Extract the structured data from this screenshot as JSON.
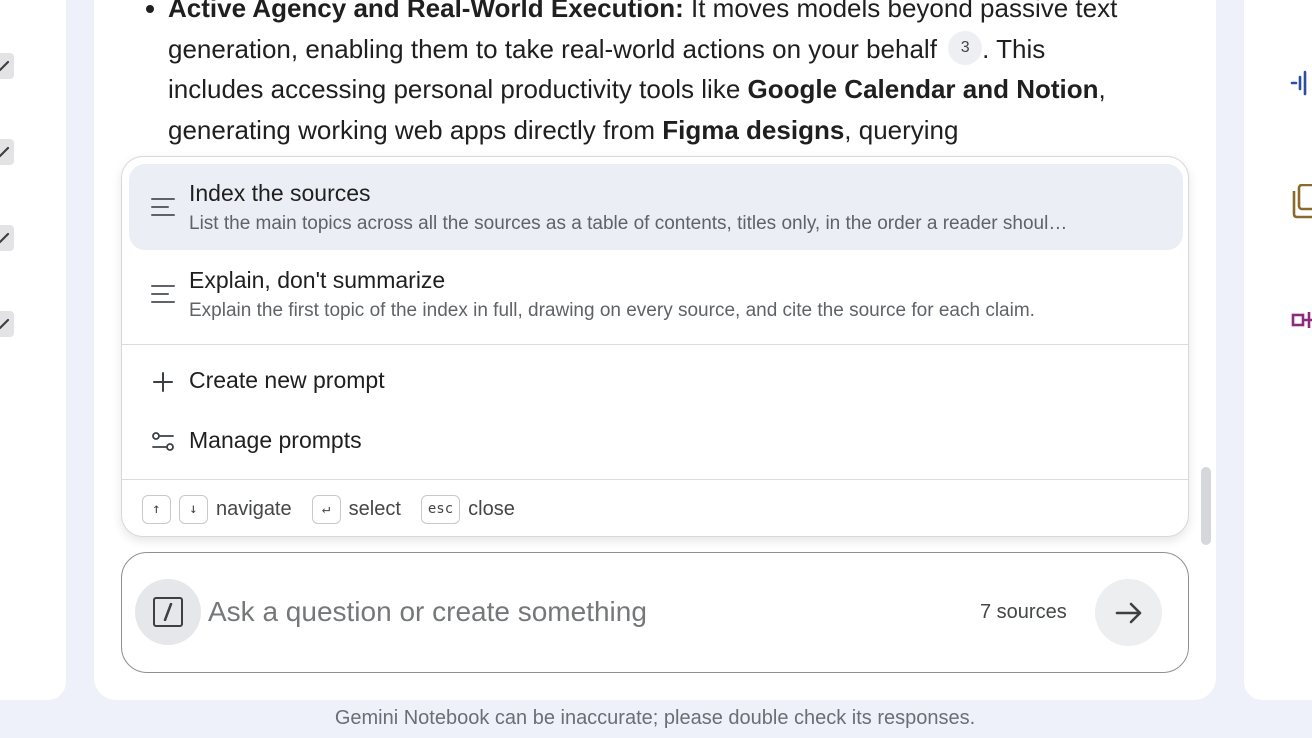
{
  "answer": {
    "bullet_lead": "Active Agency and Real-World Execution:",
    "text_1": " It moves models beyond passive text generation, enabling them to take real-world actions on your behalf",
    "citation": "3",
    "text_2": ". This includes accessing personal productivity tools like ",
    "bold_1": "Google Calendar and Notion",
    "text_3": ", generating working web apps directly from ",
    "bold_2": "Figma designs",
    "text_4": ", querying"
  },
  "prompt_menu": {
    "items": [
      {
        "title": "Index the sources",
        "description": "List the main topics across all the sources as a table of contents, titles only, in the order a reader shoul…",
        "highlighted": true
      },
      {
        "title": "Explain, don't summarize",
        "description": "Explain the first topic of the index in full, drawing on every source, and cite the source for each claim.",
        "highlighted": false
      }
    ],
    "create_label": "Create new prompt",
    "manage_label": "Manage prompts",
    "hints": {
      "up_key": "↑",
      "down_key": "↓",
      "navigate_label": "navigate",
      "enter_key": "↵",
      "select_label": "select",
      "esc_key": "esc",
      "close_label": "close"
    }
  },
  "composer": {
    "placeholder": "Ask a question or create something",
    "value": "",
    "sources_count": "7 sources"
  },
  "footer": {
    "disclaimer": "Gemini Notebook can be inaccurate; please double check its responses."
  },
  "icons": {
    "left_rail": [
      "pencil-icon",
      "pencil-icon",
      "pencil-icon",
      "pencil-icon"
    ],
    "right_rail": [
      "audio-waveform-icon",
      "copy-icon",
      "mind-map-icon"
    ],
    "composer_left": "slash-command-icon",
    "send": "arrow-right-icon"
  },
  "colors": {
    "page_bg": "#eef0fa",
    "highlight": "#eceef6",
    "mind_map_accent": "#8e2a7e",
    "copy_accent": "#8a6a2a",
    "waveform_accent": "#2a4f9e"
  }
}
